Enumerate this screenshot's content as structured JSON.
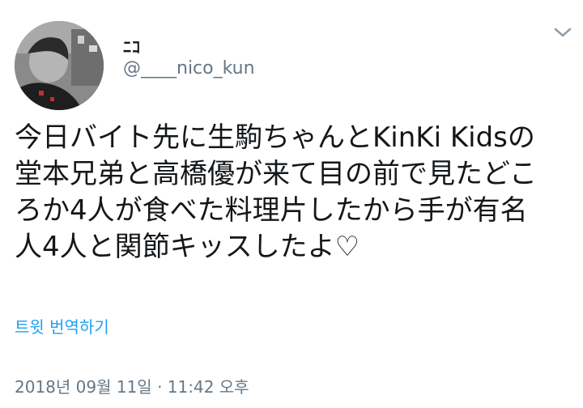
{
  "tweet": {
    "author": {
      "display_name": "ﾆｺ",
      "handle": "@____nico_kun"
    },
    "text": "今日バイト先に生駒ちゃんとKinKi Kidsの\n堂本兄弟と高橋優が来て目の前で見たどこ\nろか4人が食べた料理片したから手が有名\n人4人と関節キッスしたよ♡",
    "translate_label": "트윗 번역하기",
    "timestamp": "2018년 09월 11일 · 11:42 오후"
  },
  "icons": {
    "more": "chevron-down-icon",
    "avatar": "avatar-photo"
  },
  "colors": {
    "text": "#14171a",
    "secondary": "#657786",
    "link": "#1da1f2"
  }
}
